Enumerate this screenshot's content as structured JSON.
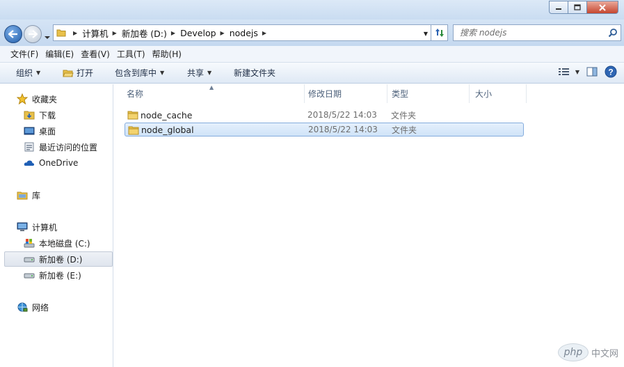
{
  "window": {
    "controls": [
      "minimize",
      "maximize",
      "close"
    ]
  },
  "address": {
    "crumbs": [
      "计算机",
      "新加卷 (D:)",
      "Develop",
      "nodejs"
    ]
  },
  "search": {
    "placeholder": "搜索 nodejs"
  },
  "menubar": {
    "items": [
      "文件(F)",
      "编辑(E)",
      "查看(V)",
      "工具(T)",
      "帮助(H)"
    ]
  },
  "toolbar": {
    "organize": "组织",
    "open": "打开",
    "include_library": "包含到库中",
    "share": "共享",
    "new_folder": "新建文件夹"
  },
  "navigation": {
    "favorites": "收藏夹",
    "favorites_items": [
      "下载",
      "桌面",
      "最近访问的位置"
    ],
    "onedrive": "OneDrive",
    "libraries": "库",
    "computer": "计算机",
    "drives": [
      "本地磁盘 (C:)",
      "新加卷 (D:)",
      "新加卷 (E:)"
    ],
    "selected_drive": "新加卷 (D:)",
    "network": "网络"
  },
  "columns": {
    "name": "名称",
    "date": "修改日期",
    "type": "类型",
    "size": "大小"
  },
  "files": [
    {
      "name": "node_cache",
      "date": "2018/5/22 14:03",
      "type": "文件夹",
      "selected": false
    },
    {
      "name": "node_global",
      "date": "2018/5/22 14:03",
      "type": "文件夹",
      "selected": true
    }
  ],
  "watermark": {
    "logo": "php",
    "text": "中文网"
  },
  "colors": {
    "chrome": "#c9dcf1",
    "selection": "#cfe3f8",
    "selection_border": "#84acdd",
    "folder": "#e8c04a"
  }
}
